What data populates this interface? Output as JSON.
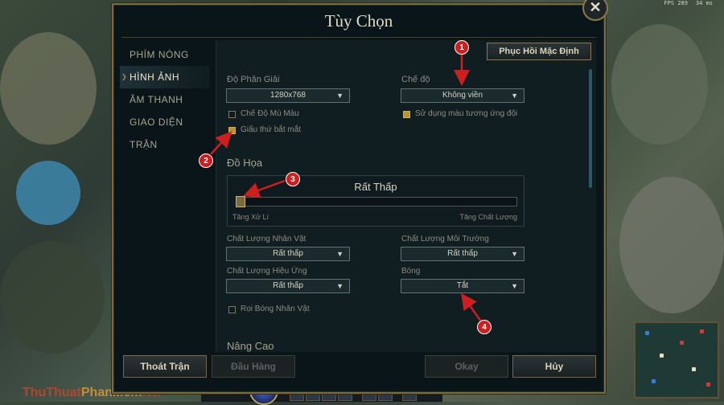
{
  "hud": {
    "fps": "FPS 289",
    "ping": "34 ms"
  },
  "dialog": {
    "title": "Tùy Chọn",
    "close_icon": "close-icon",
    "restore_default": "Phục Hồi Mặc Định"
  },
  "nav": {
    "items": [
      {
        "label": "PHÍM NÓNG"
      },
      {
        "label": "HÌNH ẢNH"
      },
      {
        "label": "ÂM THANH"
      },
      {
        "label": "GIAO DIỆN"
      },
      {
        "label": "TRẬN"
      }
    ]
  },
  "display": {
    "resolution_label": "Độ Phân Giải",
    "resolution_value": "1280x768",
    "mode_label": "Chế độ",
    "mode_value": "Không viền",
    "colorblind_label": "Chế Độ Mù Màu",
    "hide_label": "Giấu thứ bắt mắt",
    "team_color_label": "Sử dụng màu tương ứng đội"
  },
  "graphics": {
    "section_title": "Đồ Họa",
    "level_label": "Rất Thấp",
    "left_label": "Tăng Xử Lí",
    "right_label": "Tăng Chất Lượng",
    "level_fraction": 0,
    "character_quality_label": "Chất Lượng Nhân Vật",
    "character_quality_value": "Rất thấp",
    "environment_quality_label": "Chất Lượng Môi Trường",
    "environment_quality_value": "Rất thấp",
    "effects_quality_label": "Chất Lượng Hiệu Ứng",
    "effects_quality_value": "Rất thấp",
    "shadow_label": "Bóng",
    "shadow_value": "Tắt",
    "character_shadow_label": "Rọi Bóng Nhân Vật",
    "advanced_title": "Nâng Cao"
  },
  "footer": {
    "exit": "Thoát Trận",
    "surrender": "Đầu Hàng",
    "ok": "Okay",
    "cancel": "Hủy"
  },
  "annotations": [
    "1",
    "2",
    "3",
    "4"
  ],
  "watermark": {
    "part1": "ThuThuat",
    "part2": "PhanMem",
    "part3": ".vn"
  },
  "bottom_hud": {
    "stat1": "10",
    "stat2": "50",
    "stat3": "10"
  },
  "colors": {
    "accent_gold": "#8c7a46",
    "marker_red": "#cd1f1f",
    "checkbox_on": "#b8932e"
  }
}
